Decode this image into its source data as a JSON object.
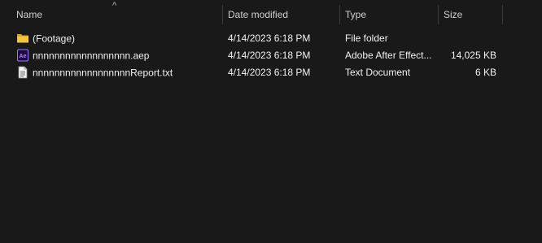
{
  "columns": {
    "name": "Name",
    "date_modified": "Date modified",
    "type": "Type",
    "size": "Size"
  },
  "sort_indicator": "^",
  "rows": [
    {
      "icon": "folder-icon",
      "name": "(Footage)",
      "date": "4/14/2023 6:18 PM",
      "type": "File folder",
      "size": ""
    },
    {
      "icon": "after-effects-file-icon",
      "name": "nnnnnnnnnnnnnnnnnn.aep",
      "date": "4/14/2023 6:18 PM",
      "type": "Adobe After Effect...",
      "size": "14,025 KB"
    },
    {
      "icon": "text-document-icon",
      "name": "nnnnnnnnnnnnnnnnnnReport.txt",
      "date": "4/14/2023 6:18 PM",
      "type": "Text Document",
      "size": "6 KB"
    }
  ],
  "colors": {
    "background": "#191919",
    "folder": "#f4c542",
    "after_effects_bg": "#1f0740",
    "after_effects_text": "#a58bff"
  }
}
